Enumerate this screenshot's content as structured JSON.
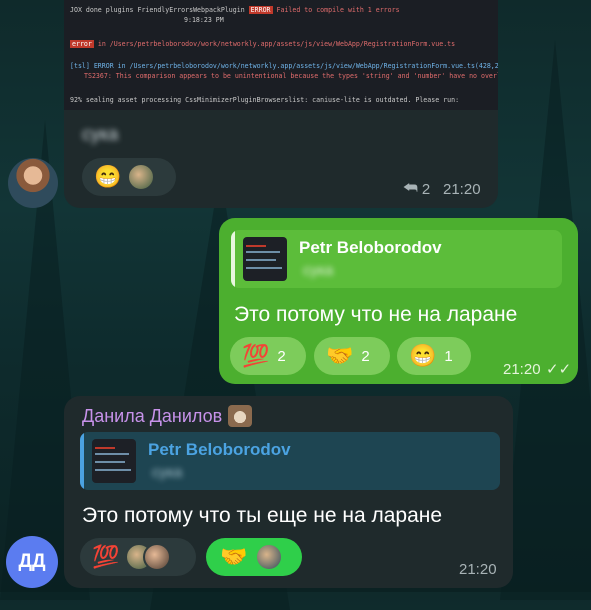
{
  "messages": {
    "first": {
      "code_lines": [
        "JOX done plugins FriendlyErrorsWebpackPlugin",
        "ERROR",
        "Failed to compile with 1 errors",
        "9:18:23 PM",
        "error",
        "in /Users/petrbeloborodov/work/networkly.app/assets/js/view/WebApp/RegistrationForm.vue.ts",
        "[tsl] ERROR in /Users/petrbeloborodov/work/networkly.app/assets/js/view/WebApp/RegistrationForm.vue.ts(428,28)",
        "TS2367: This comparison appears to be unintentional because the types 'string' and 'number' have no overlap.",
        "92% sealing asset processing CssMinimizerPluginBrowserslist: caniuse-lite is outdated. Please run:"
      ],
      "text": "сука",
      "reaction_emoji": "😁",
      "reply_count": "2",
      "time": "21:20"
    },
    "second": {
      "quote_author": "Petr Beloborodov",
      "quote_text": "сука",
      "text": "Это потому что не на ларане",
      "reactions": [
        {
          "emoji": "💯",
          "count": "2"
        },
        {
          "emoji": "🤝",
          "count": "2"
        },
        {
          "emoji": "😁",
          "count": "1"
        }
      ],
      "time": "21:20"
    },
    "third": {
      "sender": "Данила Данилов",
      "quote_author": "Petr Beloborodov",
      "quote_text": "сука",
      "text": "Это потому что ты еще не на ларане",
      "reactions": [
        {
          "emoji": "💯"
        },
        {
          "emoji": "🤝"
        }
      ],
      "time": "21:20"
    }
  },
  "avatars": {
    "dd_initials": "ДД"
  },
  "colors": {
    "incoming_bubble": "#1f2a2c",
    "outgoing_bubble": "#4caf2f",
    "accent_blue": "#4ba3e2",
    "sender_purple": "#c792ea",
    "dd_avatar": "#5b7cf0"
  }
}
